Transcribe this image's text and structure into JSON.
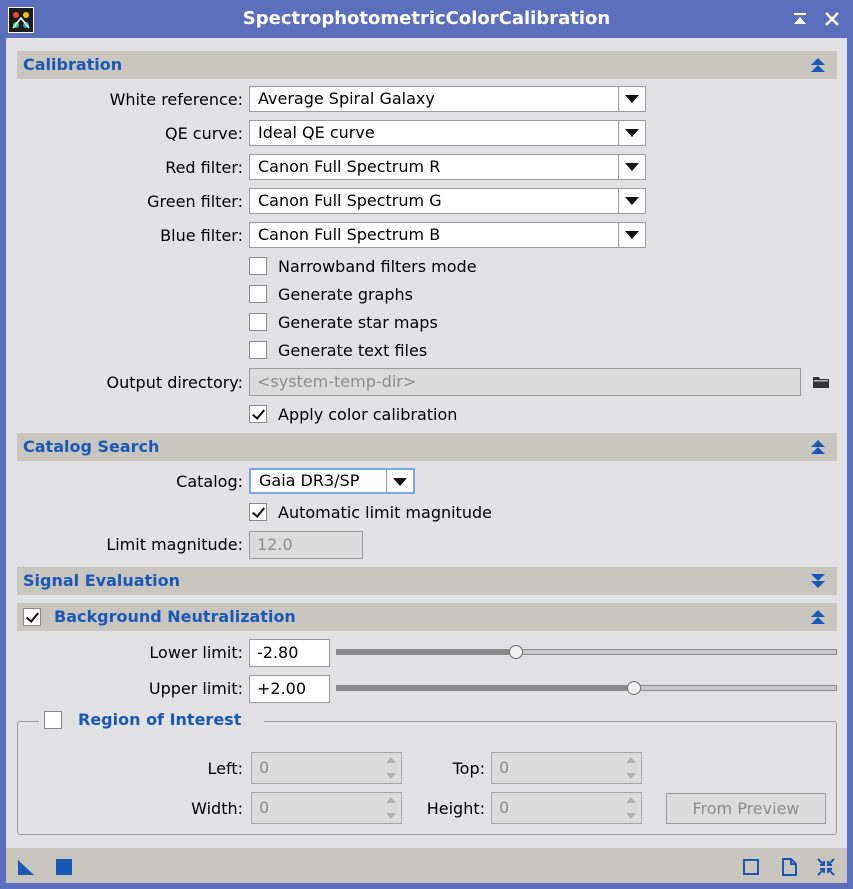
{
  "window": {
    "title": "SpectrophotometricColorCalibration",
    "accent_color": "#1958b7",
    "frame_color": "#5b6fbd"
  },
  "calibration": {
    "header": "Calibration",
    "white_reference_label": "White reference:",
    "white_reference_value": "Average Spiral Galaxy",
    "qe_curve_label": "QE curve:",
    "qe_curve_value": "Ideal QE curve",
    "red_filter_label": "Red filter:",
    "red_filter_value": "Canon Full Spectrum R",
    "green_filter_label": "Green filter:",
    "green_filter_value": "Canon Full Spectrum G",
    "blue_filter_label": "Blue filter:",
    "blue_filter_value": "Canon Full Spectrum B",
    "narrowband_label": "Narrowband filters mode",
    "narrowband_checked": false,
    "graphs_label": "Generate graphs",
    "graphs_checked": false,
    "star_maps_label": "Generate star maps",
    "star_maps_checked": false,
    "text_files_label": "Generate text files",
    "text_files_checked": false,
    "output_directory_label": "Output directory:",
    "output_directory_placeholder": "<system-temp-dir>",
    "apply_label": "Apply color calibration",
    "apply_checked": true
  },
  "catalog_search": {
    "header": "Catalog Search",
    "catalog_label": "Catalog:",
    "catalog_value": "Gaia DR3/SP",
    "auto_limit_label": "Automatic limit magnitude",
    "auto_limit_checked": true,
    "limit_magnitude_label": "Limit magnitude:",
    "limit_magnitude_value": "12.0"
  },
  "signal_evaluation": {
    "header": "Signal Evaluation",
    "collapsed": true
  },
  "background_neutralization": {
    "header": "Background Neutralization",
    "enabled": true,
    "lower_limit_label": "Lower limit:",
    "lower_limit_value": "-2.80",
    "lower_slider_fraction": 0.36,
    "upper_limit_label": "Upper limit:",
    "upper_limit_value": "+2.00",
    "upper_slider_fraction": 0.595
  },
  "region_of_interest": {
    "header": "Region of Interest",
    "enabled": false,
    "left_label": "Left:",
    "left_value": "0",
    "top_label": "Top:",
    "top_value": "0",
    "width_label": "Width:",
    "width_value": "0",
    "height_label": "Height:",
    "height_value": "0",
    "from_preview_label": "From Preview"
  }
}
